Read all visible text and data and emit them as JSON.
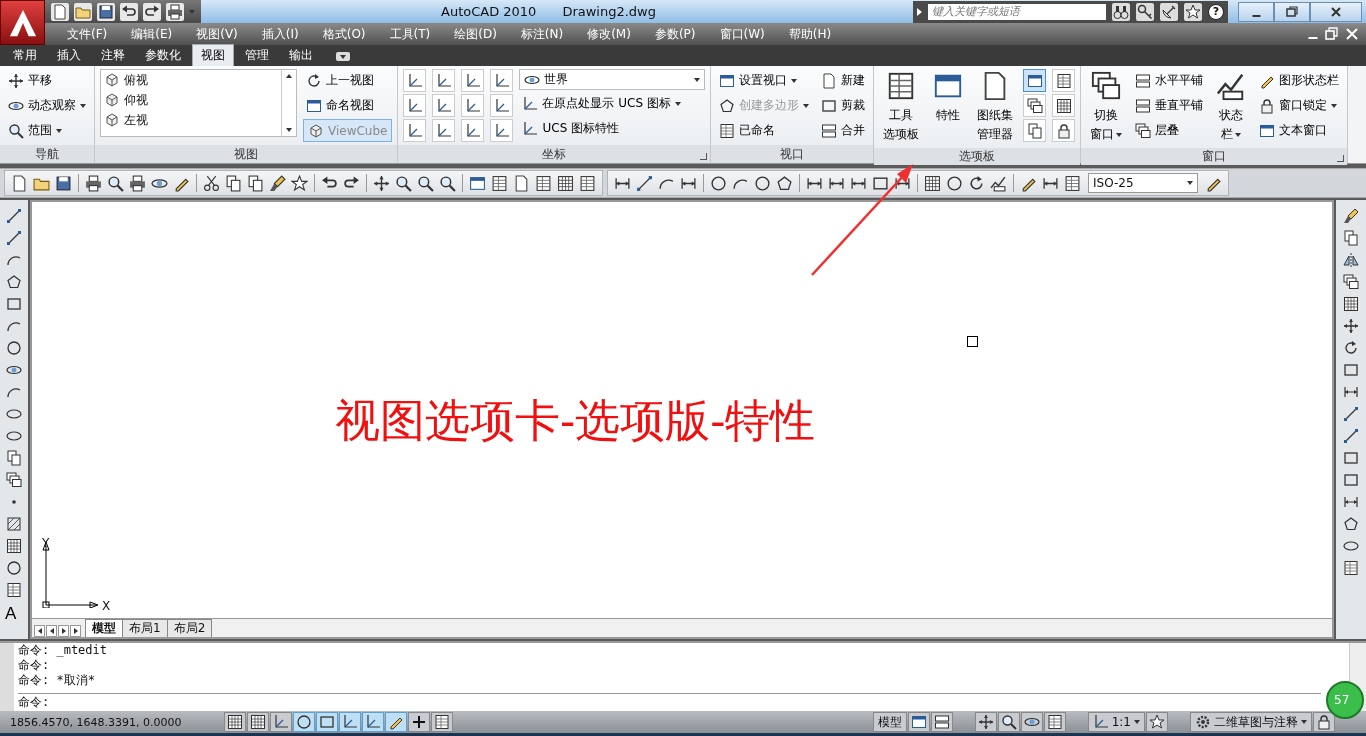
{
  "title_bar": {
    "title": "AutoCAD 2010",
    "document": "Drawing2.dwg",
    "search": {
      "placeholder": "键入关键字或短语"
    },
    "help_glyph": "?"
  },
  "menu_bar": {
    "items": [
      "文件(F)",
      "编辑(E)",
      "视图(V)",
      "插入(I)",
      "格式(O)",
      "工具(T)",
      "绘图(D)",
      "标注(N)",
      "修改(M)",
      "参数(P)",
      "窗口(W)",
      "帮助(H)"
    ]
  },
  "ribbon": {
    "tabs": [
      {
        "label": "常用",
        "selected": false
      },
      {
        "label": "插入",
        "selected": false
      },
      {
        "label": "注释",
        "selected": false
      },
      {
        "label": "参数化",
        "selected": false
      },
      {
        "label": "视图",
        "selected": true
      },
      {
        "label": "管理",
        "selected": false
      },
      {
        "label": "输出",
        "selected": false
      }
    ],
    "panels": [
      {
        "title": "导航",
        "launcher": false,
        "columns": [
          [
            {
              "kind": "small",
              "label": "平移",
              "menu": false
            },
            {
              "kind": "small",
              "label": "动态观察",
              "menu": true
            },
            {
              "kind": "small",
              "label": "范围",
              "menu": true
            }
          ]
        ]
      },
      {
        "title": "视图",
        "launcher": false,
        "columns": [
          [
            {
              "kind": "list",
              "entries": [
                "俯视",
                "仰视",
                "左视"
              ]
            }
          ],
          [
            {
              "kind": "small",
              "label": "上一视图",
              "menu": false
            },
            {
              "kind": "small",
              "label": "命名视图",
              "menu": false
            },
            {
              "kind": "toggle",
              "label": "ViewCube",
              "on": true
            }
          ]
        ]
      },
      {
        "title": "坐标",
        "launcher": true,
        "columns": [
          [
            {
              "kind": "icon",
              "selected": false
            },
            {
              "kind": "icon",
              "selected": false
            },
            {
              "kind": "icon",
              "selected": false
            }
          ],
          [
            {
              "kind": "icon",
              "selected": false
            },
            {
              "kind": "icon",
              "selected": false
            },
            {
              "kind": "icon",
              "selected": false
            }
          ],
          [
            {
              "kind": "icon",
              "selected": false
            },
            {
              "kind": "icon",
              "selected": false
            },
            {
              "kind": "icon",
              "selected": false
            }
          ],
          [
            {
              "kind": "icon",
              "selected": false
            },
            {
              "kind": "icon",
              "selected": false
            },
            {
              "kind": "icon",
              "selected": false
            }
          ],
          [
            {
              "kind": "dropdown",
              "label": "世界"
            },
            {
              "kind": "small",
              "label": "在原点处显示 UCS 图标",
              "menu": true
            },
            {
              "kind": "small",
              "label": "UCS 图标特性",
              "menu": false
            }
          ]
        ]
      },
      {
        "title": "视口",
        "launcher": false,
        "columns": [
          [
            {
              "kind": "small",
              "label": "设置视口",
              "menu": true,
              "disabled": false
            },
            {
              "kind": "small",
              "label": "创建多边形",
              "menu": true,
              "disabled": true
            },
            {
              "kind": "small",
              "label": "已命名",
              "menu": false,
              "disabled": false
            }
          ],
          [
            {
              "kind": "small",
              "label": "新建",
              "menu": false,
              "disabled": false
            },
            {
              "kind": "small",
              "label": "剪裁",
              "menu": false,
              "disabled": false
            },
            {
              "kind": "small",
              "label": "合并",
              "menu": false,
              "disabled": false
            }
          ]
        ]
      },
      {
        "title": "选项板",
        "launcher": false,
        "columns": [
          [
            {
              "kind": "large",
              "lines": [
                "工具",
                "选项板"
              ],
              "menu": false
            }
          ],
          [
            {
              "kind": "large",
              "lines": [
                "特性"
              ],
              "menu": false
            }
          ],
          [
            {
              "kind": "large",
              "lines": [
                "图纸集",
                "管理器"
              ],
              "menu": false
            }
          ],
          [
            {
              "kind": "icon",
              "selected": true
            },
            {
              "kind": "icon",
              "selected": false
            },
            {
              "kind": "icon",
              "selected": false
            }
          ],
          [
            {
              "kind": "icon",
              "selected": false
            },
            {
              "kind": "icon",
              "selected": false
            },
            {
              "kind": "icon",
              "selected": false
            }
          ]
        ]
      },
      {
        "title": "窗口",
        "launcher": true,
        "columns": [
          [
            {
              "kind": "large",
              "lines": [
                "切换",
                "窗口"
              ],
              "menu": true
            }
          ],
          [
            {
              "kind": "small",
              "label": "水平平铺",
              "menu": false
            },
            {
              "kind": "small",
              "label": "垂直平铺",
              "menu": false
            },
            {
              "kind": "small",
              "label": "层叠",
              "menu": false
            }
          ],
          [
            {
              "kind": "large",
              "lines": [
                "状态",
                "栏"
              ],
              "menu": true
            }
          ],
          [
            {
              "kind": "small",
              "label": "图形状态栏",
              "menu": false
            },
            {
              "kind": "small",
              "label": "窗口锁定",
              "menu": true
            },
            {
              "kind": "small",
              "label": "文本窗口",
              "menu": false
            }
          ]
        ]
      }
    ]
  },
  "toolbar": {
    "dim_style": "ISO-25"
  },
  "left_toolbar": {
    "text_tool": "A"
  },
  "canvas": {
    "annotation": "视图选项卡-选项版-特性",
    "ucs": {
      "x": "X",
      "y": "Y"
    }
  },
  "layout_tabs": [
    {
      "label": "模型",
      "selected": true
    },
    {
      "label": "布局1",
      "selected": false
    },
    {
      "label": "布局2",
      "selected": false
    }
  ],
  "command_line": {
    "history": [
      "命令: _mtedit",
      "命令:",
      "命令: *取消*"
    ],
    "prompt": "命令:"
  },
  "status_bar": {
    "coordinates": "1856.4570, 1648.3391, 0.0000",
    "toggles": [
      {
        "on": false
      },
      {
        "on": false
      },
      {
        "on": false
      },
      {
        "on": true
      },
      {
        "on": true
      },
      {
        "on": true
      },
      {
        "on": true
      },
      {
        "on": true
      },
      {
        "on": false
      },
      {
        "on": false
      }
    ],
    "space": "模型",
    "scale": "1:1",
    "workspace": "二维草图与注释"
  },
  "badge": "57"
}
